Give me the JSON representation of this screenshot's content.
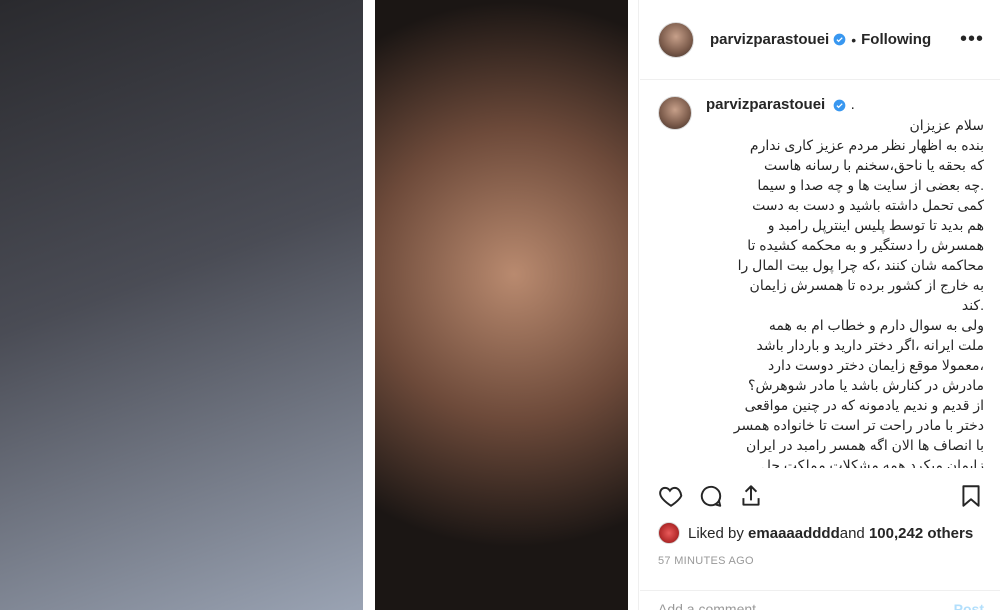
{
  "media": {
    "left_photo_label": "",
    "right_photo_label": ""
  },
  "header": {
    "username": "parvizparastouei",
    "separator": "•",
    "follow_status": "Following",
    "more": "•••"
  },
  "caption": {
    "username": "parvizparastouei",
    "username_suffix": " .",
    "text": "سلام عزیزان\nبنده به اظهار نظر مردم عزیز کاری ندارم\nکه بحقه یا ناحق،سخنم با رسانه هاست\n.چه بعضی از سایت ها و چه صدا و سیما\nکمی تحمل داشته باشید و دست به دست\nهم بدید تا توسط پلیس اینترپل رامبد و\nهمسرش را دستگیر و به محکمه کشیده تا\nمحاکمه شان کنند ،که چرا پول بیت المال را\nبه خارج از کشور برده تا همسرش زایمان\n.کند\nولی به سوال دارم و خطاب ام به همه\nملت ایرانه ،اگر دختر دارید و باردار باشد\n،معمولا موقع زایمان دختر دوست دارد\nمادرش در کنارش باشد یا مادر شوهرش؟\nاز قدیم و ندیم یادمونه که در چنین مواقعی\nدختر با مادر راحت تر است تا خانواده همسر\nبا انصاف ها الان اگه همسر رامبد در ایران\nزایمان میکرد همه مشکلات مملکت حل\nمیشد؟"
  },
  "actions": {
    "like": "heart-icon",
    "comment": "comment-icon",
    "share": "share-icon",
    "save": "bookmark-icon"
  },
  "likes": {
    "prefix": "Liked by ",
    "user": "emaaaadddd",
    "middle": " and ",
    "others": "100,242 others"
  },
  "timestamp": "57 MINUTES AGO",
  "add_comment": {
    "placeholder": "Add a comment…",
    "post_label": "Post"
  },
  "colors": {
    "verified": "#3897f0",
    "text": "#262626",
    "muted": "#999999",
    "post_disabled": "#b2dffc"
  }
}
